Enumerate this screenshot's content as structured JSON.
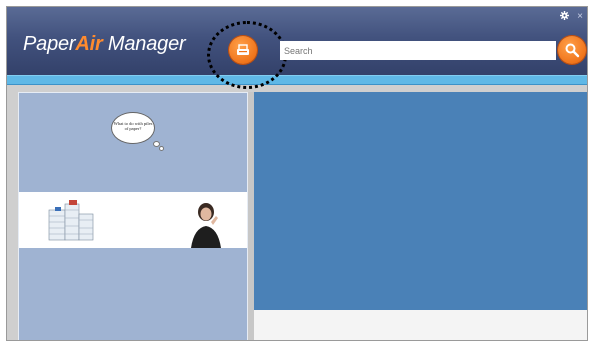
{
  "app": {
    "logo_part1": "Paper",
    "logo_part2": "Air",
    "logo_part3": " Manager"
  },
  "window_controls": {
    "settings_icon": "gear-icon",
    "close_icon": "close-icon",
    "close_glyph": "×"
  },
  "toolbar": {
    "scan_icon": "scanner-icon",
    "search_placeholder": "Search",
    "search_icon": "search-icon"
  },
  "left_panel": {
    "banner_text": "What to do with piles of paper?"
  },
  "colors": {
    "accent_orange": "#f0741a",
    "title_bar": "#42527e",
    "blue_strip": "#5fb8e6",
    "right_panel": "#4a81b7",
    "left_panel": "#9fb3d2"
  }
}
